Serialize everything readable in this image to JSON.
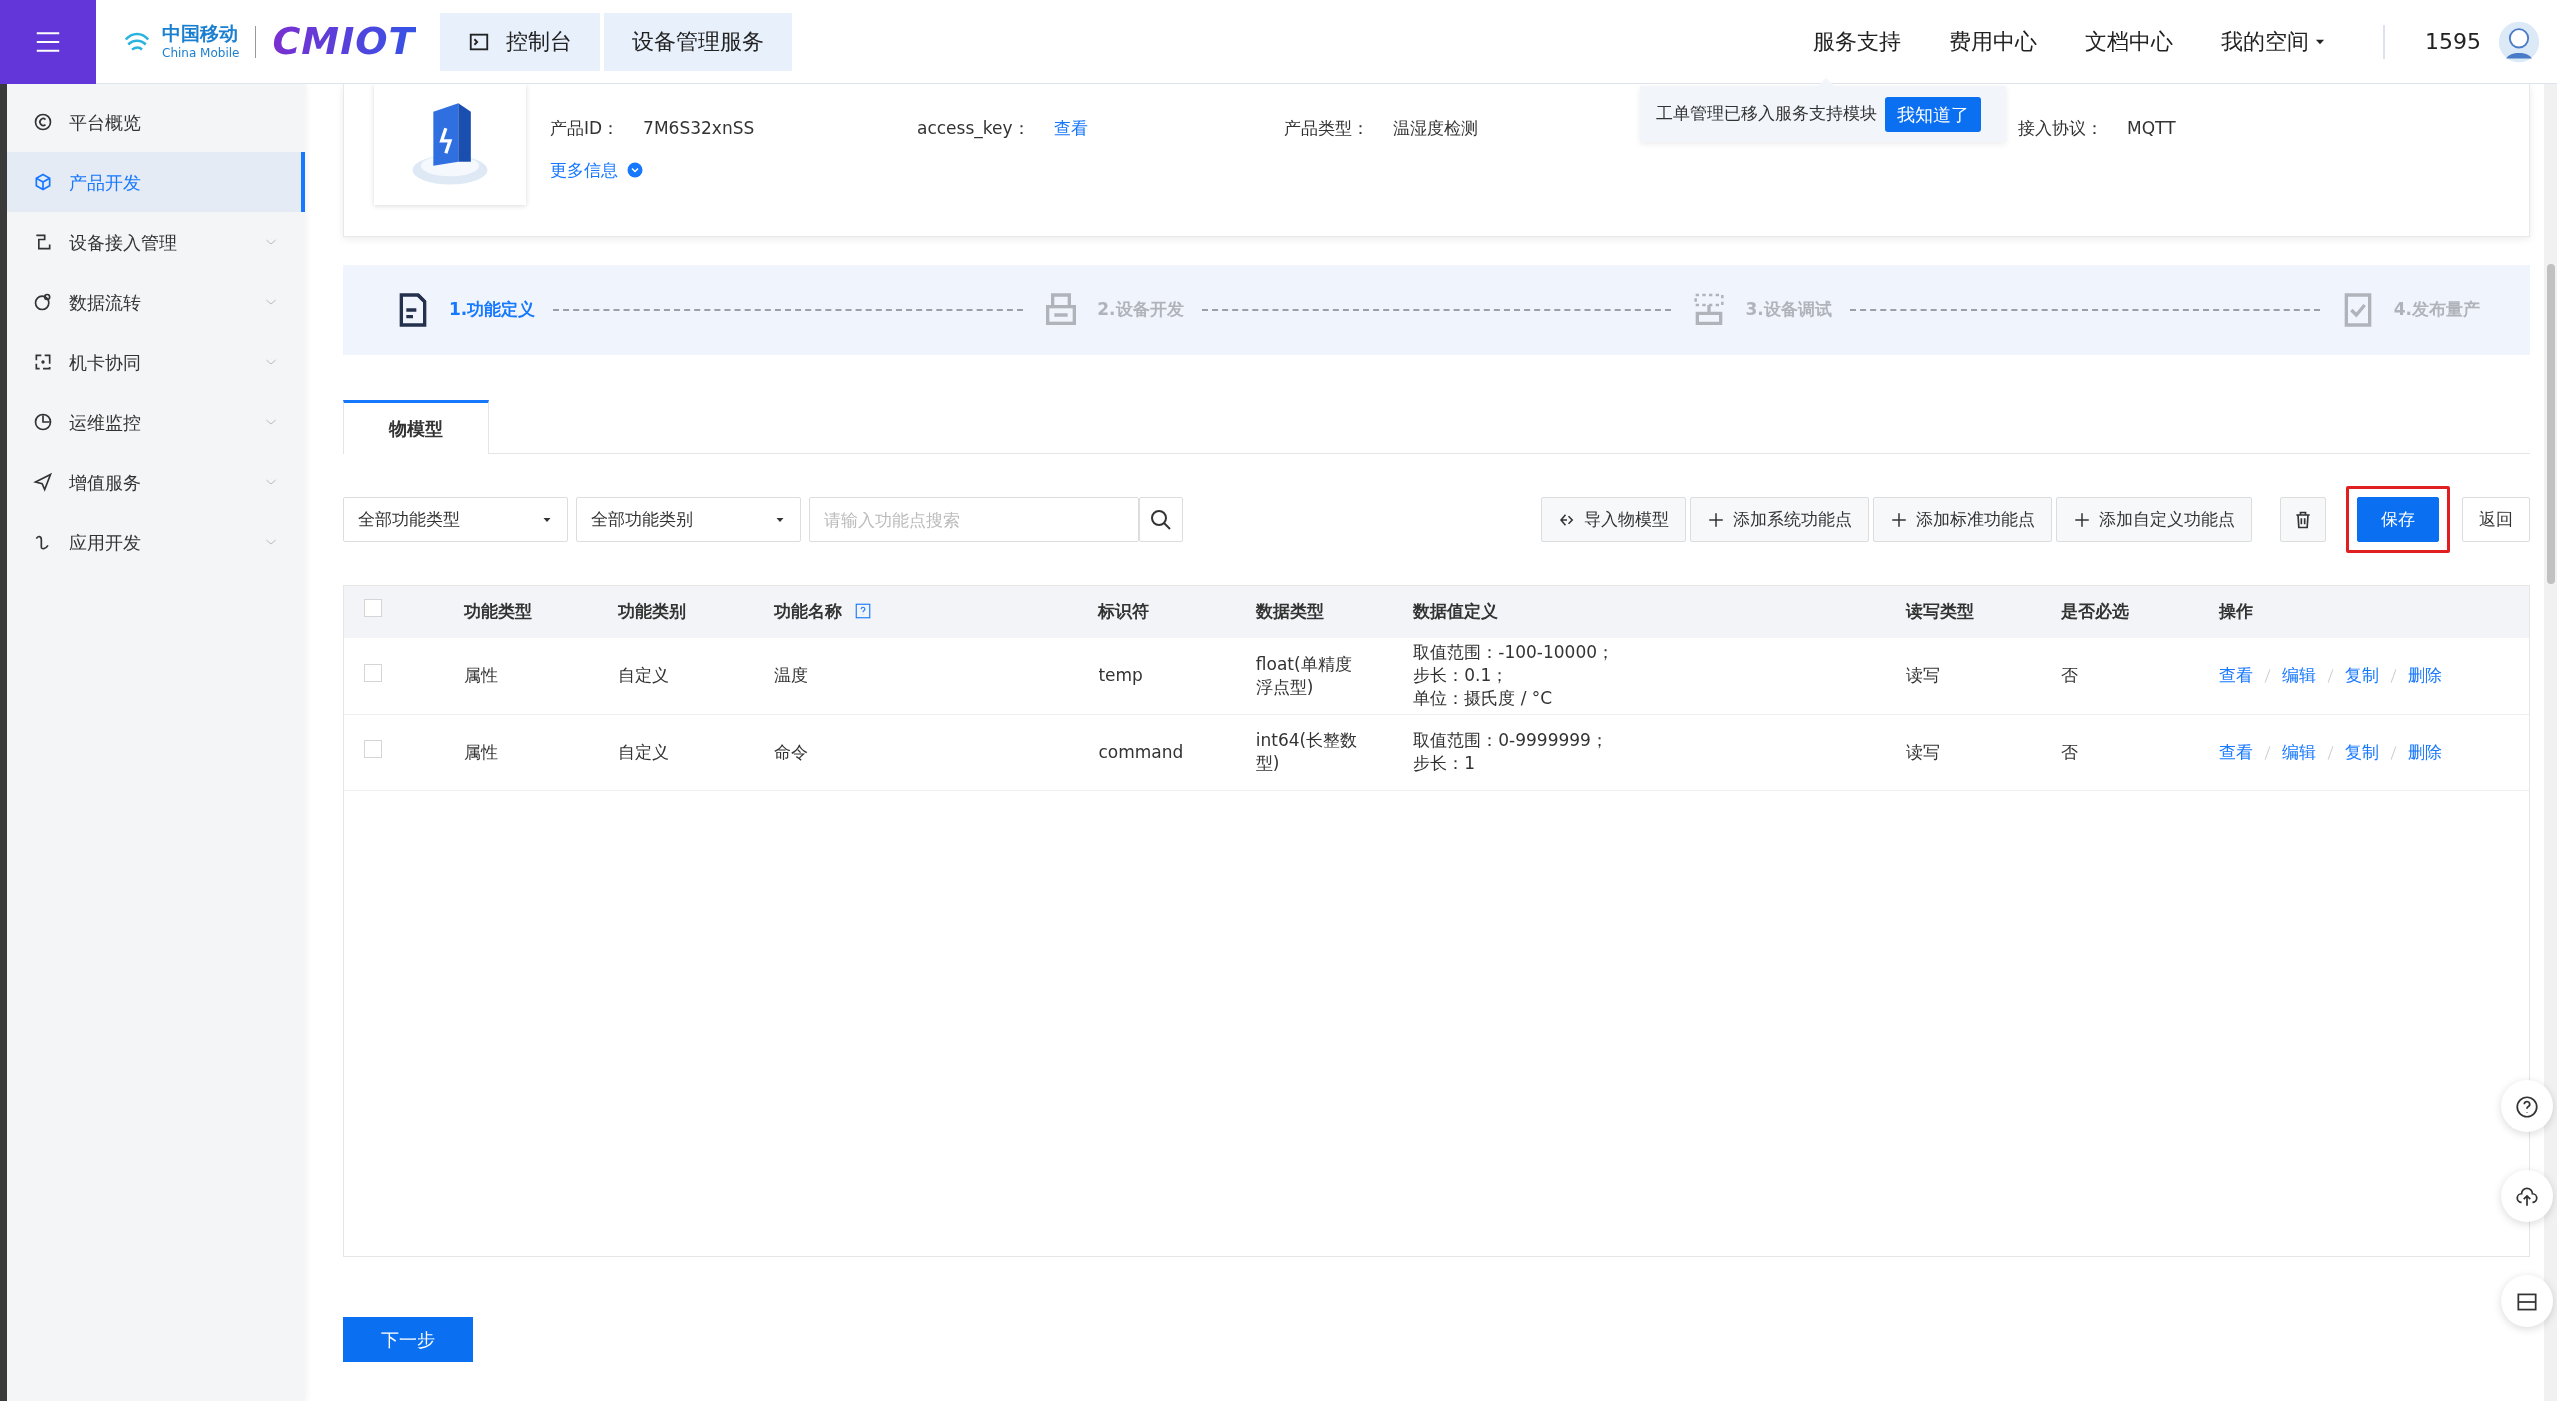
{
  "header": {
    "brand_cn": "中国移动",
    "brand_en": "China Mobile",
    "logo_text": "CMIOT",
    "breadcrumbs": [
      "控制台",
      "设备管理服务"
    ],
    "nav": [
      {
        "label": "服务支持",
        "dropdown": false
      },
      {
        "label": "费用中心",
        "dropdown": false
      },
      {
        "label": "文档中心",
        "dropdown": false
      },
      {
        "label": "我的空间",
        "dropdown": true
      }
    ],
    "user_id": "1595"
  },
  "tooltip": {
    "text": "工单管理已移入服务支持模块",
    "button": "我知道了"
  },
  "sidebar": {
    "items": [
      {
        "label": "平台概览",
        "selected": false,
        "expandable": false
      },
      {
        "label": "产品开发",
        "selected": true,
        "expandable": false
      },
      {
        "label": "设备接入管理",
        "selected": false,
        "expandable": true
      },
      {
        "label": "数据流转",
        "selected": false,
        "expandable": true
      },
      {
        "label": "机卡协同",
        "selected": false,
        "expandable": true
      },
      {
        "label": "运维监控",
        "selected": false,
        "expandable": true
      },
      {
        "label": "增值服务",
        "selected": false,
        "expandable": true
      },
      {
        "label": "应用开发",
        "selected": false,
        "expandable": true
      }
    ]
  },
  "product": {
    "fields": [
      {
        "label": "产品ID：",
        "value": "7M6S32xnSS",
        "kind": "text"
      },
      {
        "label": "access_key：",
        "value": "查看",
        "kind": "link"
      },
      {
        "label": "产品类型：",
        "value": "温湿度检测",
        "kind": "text"
      },
      {
        "label": "接入协议：",
        "value": "MQTT",
        "kind": "text"
      }
    ],
    "more": "更多信息"
  },
  "steps": [
    {
      "label": "1.功能定义",
      "selected": true
    },
    {
      "label": "2.设备开发",
      "selected": false
    },
    {
      "label": "3.设备调试",
      "selected": false
    },
    {
      "label": "4.发布量产",
      "selected": false
    }
  ],
  "tabs": [
    {
      "label": "物模型",
      "selected": true
    }
  ],
  "filters": [
    {
      "value": "全部功能类型"
    },
    {
      "value": "全部功能类别"
    }
  ],
  "search": {
    "placeholder": "请输入功能点搜索"
  },
  "toolbar": [
    {
      "label": "导入物模型",
      "kind": "import"
    },
    {
      "label": "添加系统功能点",
      "kind": "add"
    },
    {
      "label": "添加标准功能点",
      "kind": "add"
    },
    {
      "label": "添加自定义功能点",
      "kind": "add"
    }
  ],
  "save": {
    "label": "保存",
    "highlighted": true
  },
  "back": {
    "label": "返回"
  },
  "table": {
    "header_checked": false,
    "columns": [
      {
        "label": "功能类型"
      },
      {
        "label": "功能类别"
      },
      {
        "label": "功能名称",
        "help": true
      },
      {
        "label": "标识符"
      },
      {
        "label": "数据类型"
      },
      {
        "label": "数据值定义"
      },
      {
        "label": "读写类型"
      },
      {
        "label": "是否必选"
      },
      {
        "label": "操作"
      }
    ],
    "rows": [
      {
        "checked": false,
        "type": "属性",
        "category": "自定义",
        "name": "温度",
        "identifier": "temp",
        "data_type": "float(单精度浮点型)",
        "definition": [
          "取值范围：-100-10000；",
          "步长：0.1；",
          "单位：摄氏度 / °C"
        ],
        "access": "读写",
        "required": "否",
        "actions": [
          "查看",
          "编辑",
          "复制",
          "删除"
        ]
      },
      {
        "checked": false,
        "type": "属性",
        "category": "自定义",
        "name": "命令",
        "identifier": "command",
        "data_type": "int64(长整数型)",
        "definition": [
          "取值范围：0-9999999；",
          "步长：1"
        ],
        "access": "读写",
        "required": "否",
        "actions": [
          "查看",
          "编辑",
          "复制",
          "删除"
        ]
      }
    ]
  },
  "next_button": "下一步"
}
